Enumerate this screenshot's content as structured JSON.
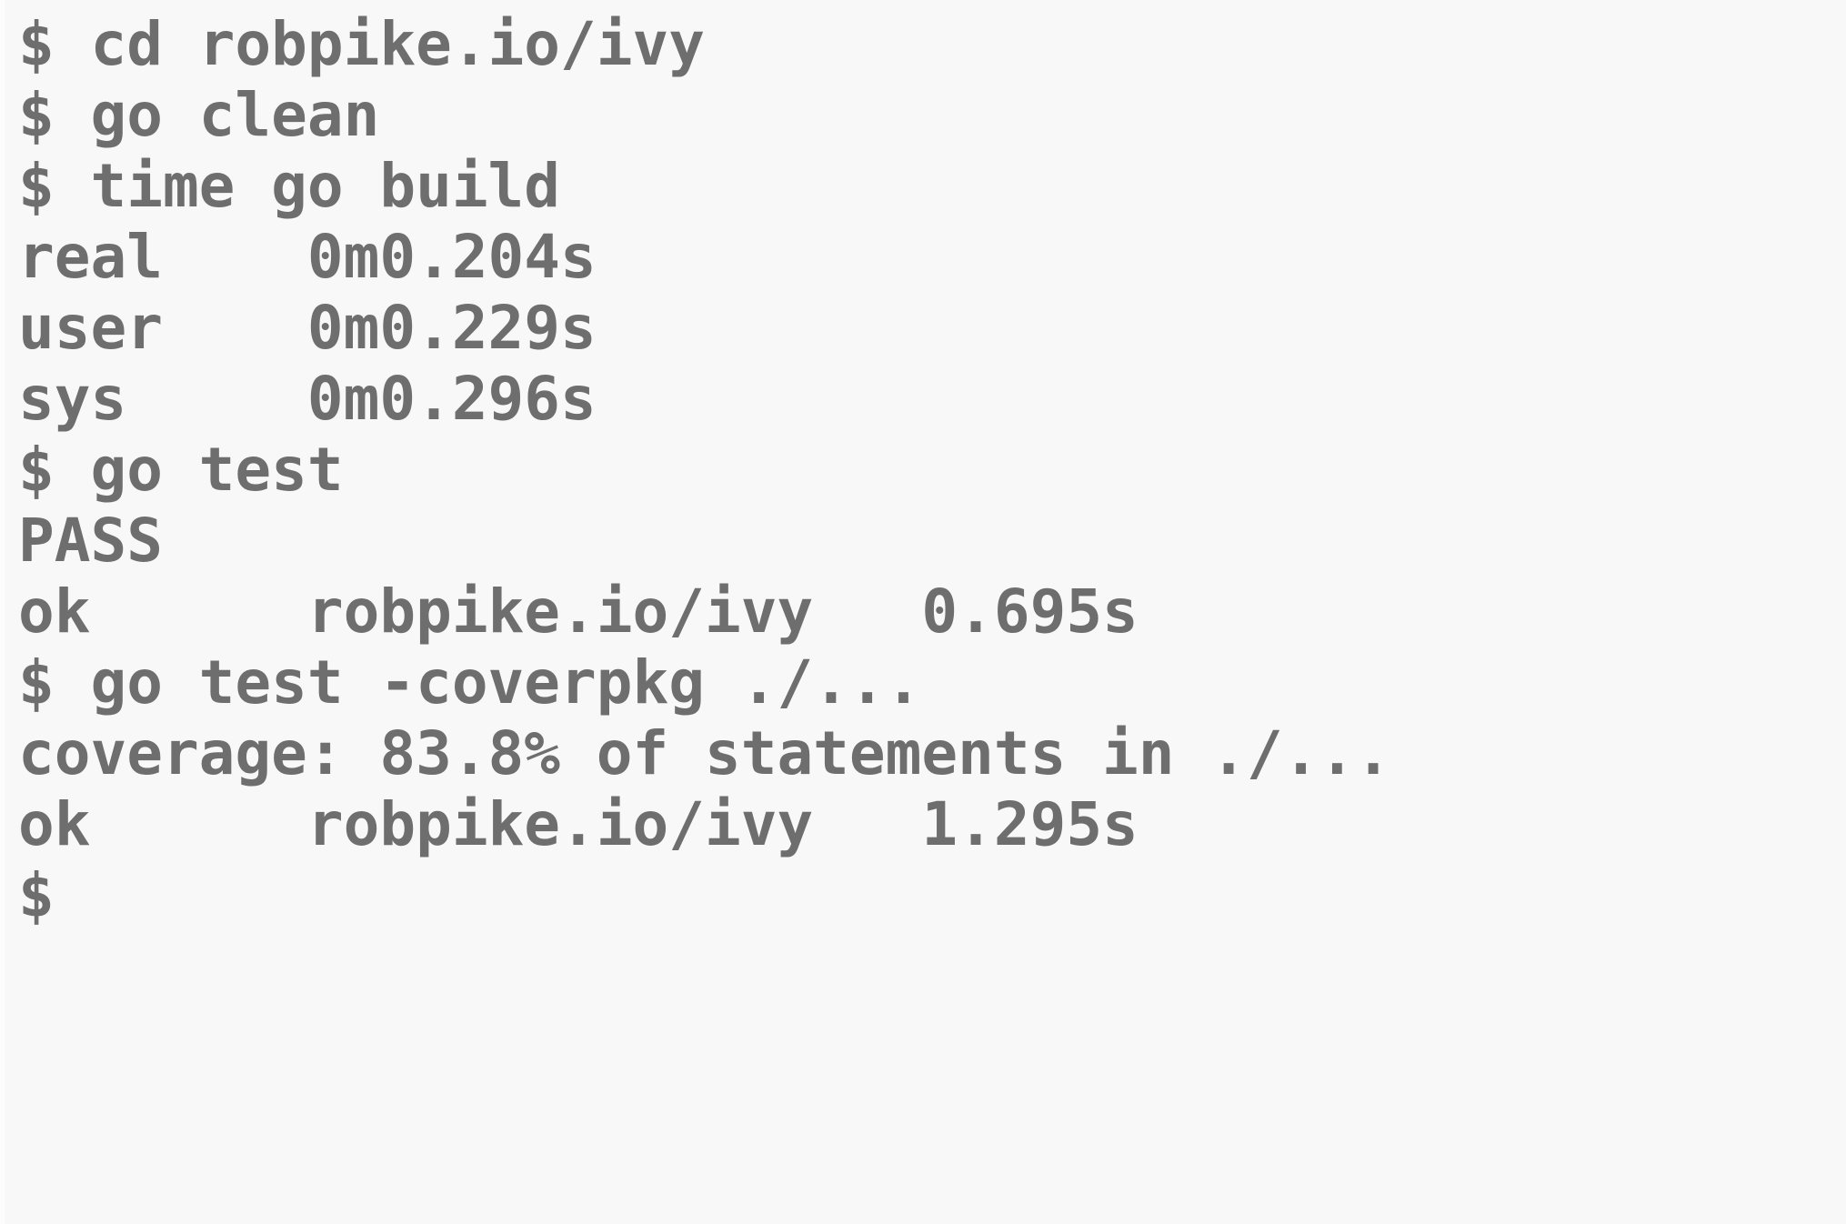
{
  "terminal": {
    "prompt_symbol": "$",
    "colors": {
      "background": "#f8f8f8",
      "foreground": "#6e6e6e",
      "gutter": "#fcfcfc"
    },
    "working_directory": "robpike.io/ivy",
    "lines": [
      {
        "id": "cmd-cd",
        "kind": "command",
        "text": "$ cd robpike.io/ivy"
      },
      {
        "id": "cmd-go-clean",
        "kind": "command",
        "text": "$ go clean"
      },
      {
        "id": "cmd-time-build",
        "kind": "command",
        "text": "$ time go build"
      },
      {
        "id": "out-real",
        "kind": "output",
        "text": "real    0m0.204s"
      },
      {
        "id": "out-user",
        "kind": "output",
        "text": "user    0m0.229s"
      },
      {
        "id": "out-sys",
        "kind": "output",
        "text": "sys     0m0.296s"
      },
      {
        "id": "cmd-go-test",
        "kind": "command",
        "text": "$ go test"
      },
      {
        "id": "out-pass",
        "kind": "output",
        "text": "PASS"
      },
      {
        "id": "out-ok-1",
        "kind": "output",
        "text": "ok      robpike.io/ivy   0.695s"
      },
      {
        "id": "cmd-go-test-cov",
        "kind": "command",
        "text": "$ go test -coverpkg ./..."
      },
      {
        "id": "out-coverage",
        "kind": "output",
        "text": "coverage: 83.8% of statements in ./..."
      },
      {
        "id": "out-ok-2",
        "kind": "output",
        "text": "ok      robpike.io/ivy   1.295s"
      },
      {
        "id": "prompt-final",
        "kind": "prompt",
        "text": "$"
      }
    ],
    "timings": {
      "build": {
        "real": "0m0.204s",
        "user": "0m0.229s",
        "sys": "0m0.296s"
      },
      "test_plain": {
        "package": "robpike.io/ivy",
        "status": "ok",
        "duration": "0.695s",
        "result": "PASS"
      },
      "test_coverpkg": {
        "package": "robpike.io/ivy",
        "status": "ok",
        "duration": "1.295s",
        "coverage_percent": "83.8%",
        "coverage_scope": "./..."
      }
    }
  }
}
